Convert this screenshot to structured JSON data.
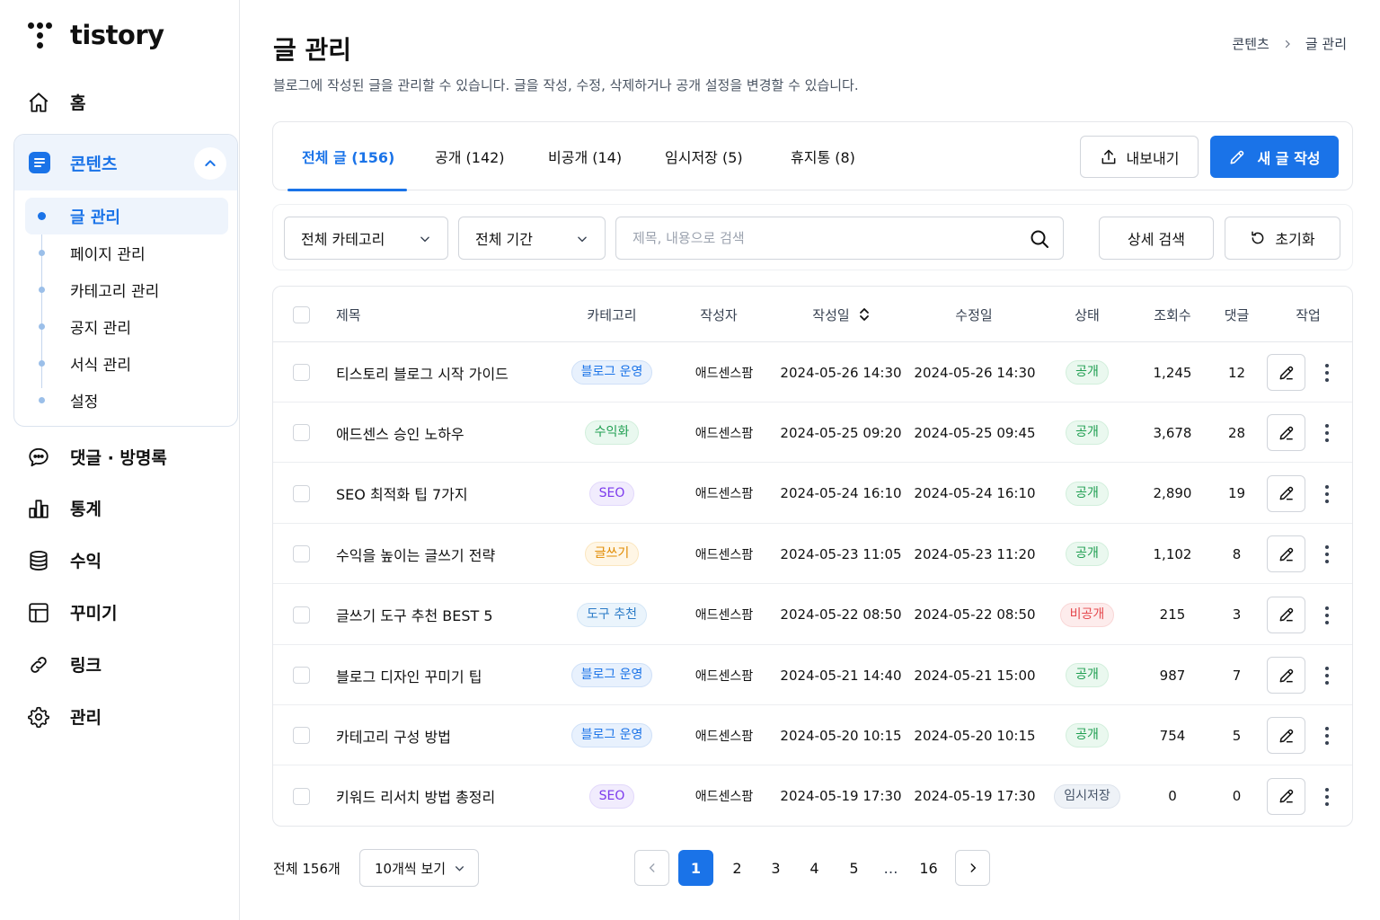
{
  "brand": {
    "name": "tistory"
  },
  "sidebar": {
    "home": "홈",
    "contents": {
      "label": "콘텐츠",
      "items": [
        {
          "label": "글 관리",
          "active": true
        },
        {
          "label": "페이지 관리"
        },
        {
          "label": "카테고리 관리"
        },
        {
          "label": "공지 관리"
        },
        {
          "label": "서식 관리"
        },
        {
          "label": "설정"
        }
      ]
    },
    "nav": [
      {
        "label": "댓글 · 방명록",
        "icon": "chat-icon"
      },
      {
        "label": "통계",
        "icon": "bar-chart-icon"
      },
      {
        "label": "수익",
        "icon": "database-icon"
      },
      {
        "label": "꾸미기",
        "icon": "layout-icon"
      },
      {
        "label": "링크",
        "icon": "link-icon"
      },
      {
        "label": "관리",
        "icon": "gear-icon"
      }
    ]
  },
  "header": {
    "title": "글 관리",
    "description": "블로그에 작성된 글을 관리할 수 있습니다. 글을 작성, 수정, 삭제하거나 공개 설정을 변경할 수 있습니다.",
    "breadcrumb": [
      "콘텐츠",
      "글 관리"
    ]
  },
  "tabs": [
    {
      "label": "전체 글 (156)",
      "active": true
    },
    {
      "label": "공개 (142)"
    },
    {
      "label": "비공개 (14)"
    },
    {
      "label": "임시저장 (5)"
    },
    {
      "label": "휴지통 (8)"
    }
  ],
  "actions": {
    "export": "내보내기",
    "new_post": "새 글 작성"
  },
  "filters": {
    "category": "전체 카테고리",
    "period": "전체 기간",
    "search_placeholder": "제목, 내용으로 검색",
    "advanced": "상세 검색",
    "reset": "초기화"
  },
  "table": {
    "columns": {
      "title": "제목",
      "category": "카테고리",
      "author": "작성자",
      "created": "작성일",
      "modified": "수정일",
      "status": "상태",
      "views": "조회수",
      "comments": "댓글",
      "actions": "작업"
    },
    "rows": [
      {
        "title": "티스토리 블로그 시작 가이드",
        "category": "블로그 운영",
        "author": "애드센스팜",
        "created": "2024-05-26 14:30",
        "modified": "2024-05-26 14:30",
        "status": "공개",
        "views": "1,245",
        "comments": "12"
      },
      {
        "title": "애드센스 승인 노하우",
        "category": "수익화",
        "author": "애드센스팜",
        "created": "2024-05-25 09:20",
        "modified": "2024-05-25 09:45",
        "status": "공개",
        "views": "3,678",
        "comments": "28"
      },
      {
        "title": "SEO 최적화 팁 7가지",
        "category": "SEO",
        "author": "애드센스팜",
        "created": "2024-05-24 16:10",
        "modified": "2024-05-24 16:10",
        "status": "공개",
        "views": "2,890",
        "comments": "19"
      },
      {
        "title": "수익을 높이는 글쓰기 전략",
        "category": "글쓰기",
        "author": "애드센스팜",
        "created": "2024-05-23 11:05",
        "modified": "2024-05-23 11:20",
        "status": "공개",
        "views": "1,102",
        "comments": "8"
      },
      {
        "title": "글쓰기 도구 추천 BEST 5",
        "category": "도구 추천",
        "author": "애드센스팜",
        "created": "2024-05-22 08:50",
        "modified": "2024-05-22 08:50",
        "status": "비공개",
        "views": "215",
        "comments": "3"
      },
      {
        "title": "블로그 디자인 꾸미기 팁",
        "category": "블로그 운영",
        "author": "애드센스팜",
        "created": "2024-05-21 14:40",
        "modified": "2024-05-21 15:00",
        "status": "공개",
        "views": "987",
        "comments": "7"
      },
      {
        "title": "카테고리 구성 방법",
        "category": "블로그 운영",
        "author": "애드센스팜",
        "created": "2024-05-20 10:15",
        "modified": "2024-05-20 10:15",
        "status": "공개",
        "views": "754",
        "comments": "5"
      },
      {
        "title": "키워드 리서치 방법 총정리",
        "category": "SEO",
        "author": "애드센스팜",
        "created": "2024-05-19 17:30",
        "modified": "2024-05-19 17:30",
        "status": "임시저장",
        "views": "0",
        "comments": "0"
      }
    ]
  },
  "category_colors": {
    "블로그 운영": {
      "bg": "#e8f1fd",
      "fg": "#1a73e8",
      "border": "#cfe0f8"
    },
    "수익화": {
      "bg": "#e9f8ef",
      "fg": "#1e9e50",
      "border": "#d2efdc"
    },
    "SEO": {
      "bg": "#f1ecfd",
      "fg": "#7c3aed",
      "border": "#e2d8fb"
    },
    "글쓰기": {
      "bg": "#fff6e5",
      "fg": "#e08a00",
      "border": "#fbe6bf"
    },
    "도구 추천": {
      "bg": "#eaf4fc",
      "fg": "#2b7bc7",
      "border": "#d4e6f6"
    }
  },
  "status_colors": {
    "공개": {
      "bg": "#eaf8ef",
      "fg": "#1e9e50",
      "border": "#d2efdc"
    },
    "비공개": {
      "bg": "#fdecec",
      "fg": "#e5484d",
      "border": "#f9d6d6"
    },
    "임시저장": {
      "bg": "#eef2f7",
      "fg": "#475569",
      "border": "#dde3ec"
    }
  },
  "footer": {
    "total": "전체 156개",
    "page_size": "10개씩 보기",
    "pages": [
      "1",
      "2",
      "3",
      "4",
      "5",
      "…",
      "16"
    ],
    "current_page": "1"
  }
}
